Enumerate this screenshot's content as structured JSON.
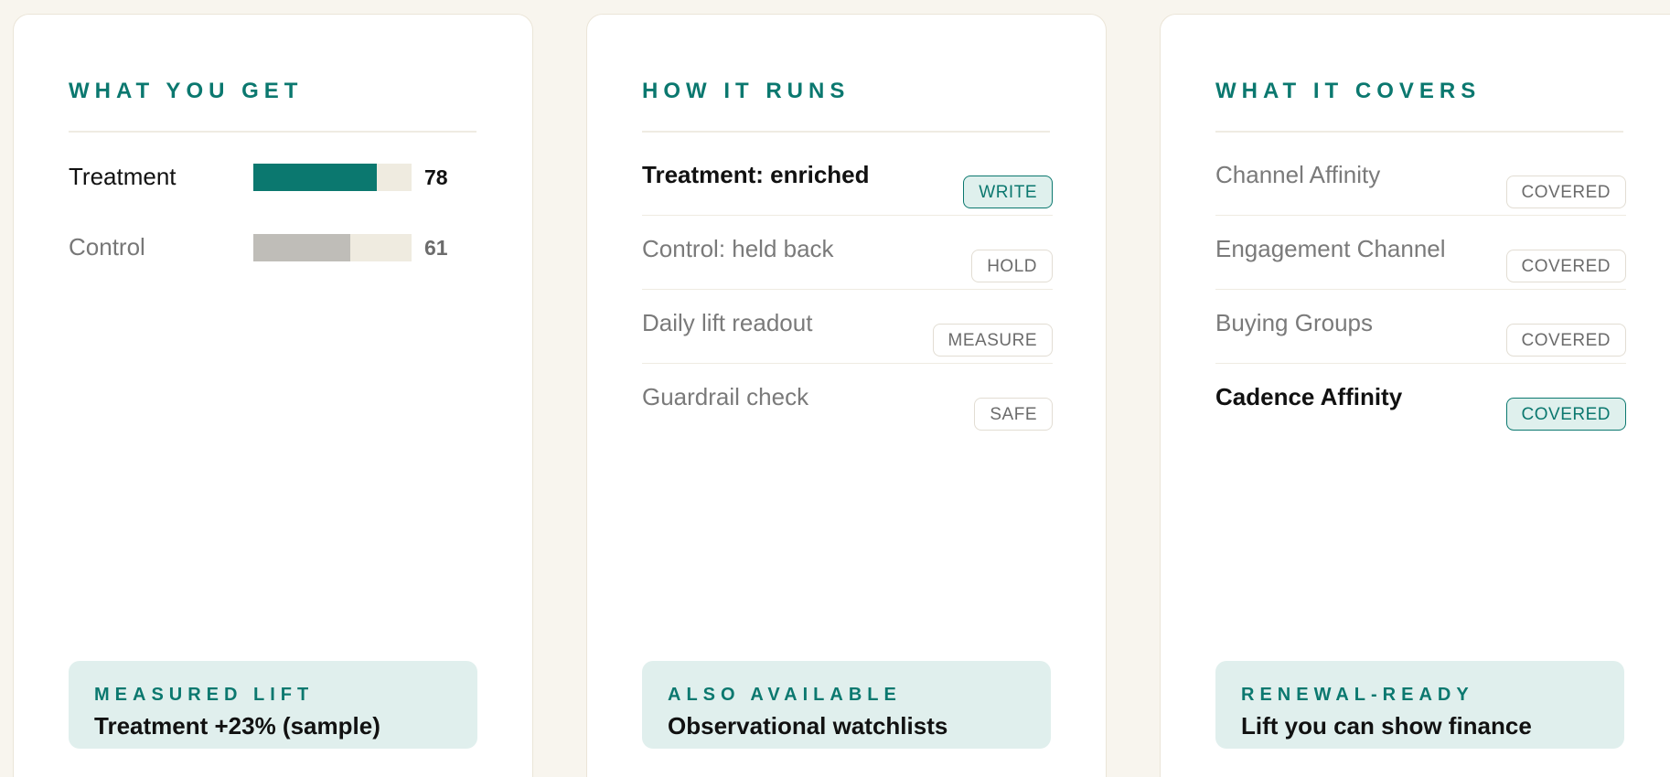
{
  "colors": {
    "accent": "#0b786f",
    "bar_control": "#bfbdb8",
    "callout_bg": "#e0efed"
  },
  "cards": [
    {
      "heading": "WHAT YOU GET",
      "bars": [
        {
          "label": "Treatment",
          "value": "78",
          "fraction": 0.78
        },
        {
          "label": "Control",
          "value": "61",
          "fraction": 0.61
        }
      ],
      "callout": {
        "eyebrow": "MEASURED LIFT",
        "text": "Treatment +23% (sample)"
      }
    },
    {
      "heading": "HOW IT RUNS",
      "items": [
        {
          "label": "Treatment: enriched",
          "tag": "WRITE",
          "active": true
        },
        {
          "label": "Control: held back",
          "tag": "HOLD",
          "active": false
        },
        {
          "label": "Daily lift readout",
          "tag": "MEASURE",
          "active": false
        },
        {
          "label": "Guardrail check",
          "tag": "SAFE",
          "active": false
        }
      ],
      "callout": {
        "eyebrow": "ALSO AVAILABLE",
        "text": "Observational watchlists"
      }
    },
    {
      "heading": "WHAT IT COVERS",
      "items": [
        {
          "label": "Channel Affinity",
          "tag": "COVERED",
          "active": false
        },
        {
          "label": "Engagement Channel",
          "tag": "COVERED",
          "active": false
        },
        {
          "label": "Buying Groups",
          "tag": "COVERED",
          "active": false
        },
        {
          "label": "Cadence Affinity",
          "tag": "COVERED",
          "active": true
        }
      ],
      "callout": {
        "eyebrow": "RENEWAL-READY",
        "text": "Lift you can show finance"
      }
    }
  ]
}
